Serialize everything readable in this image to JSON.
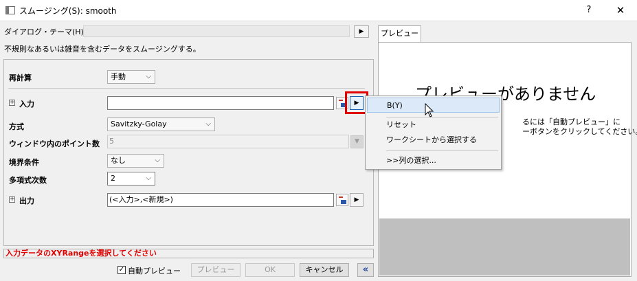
{
  "window": {
    "title": "スムージング(S): smooth",
    "help": "?",
    "close": "✕"
  },
  "theme": {
    "label": "ダイアログ・テーマ(H)",
    "arrow": "▶"
  },
  "description": "不規則なあるいは雑音を含むデータをスムージングする。",
  "form": {
    "recalc": {
      "label": "再計算",
      "value": "手動"
    },
    "input": {
      "label": "入力",
      "value": "",
      "expander": "⊞",
      "arrow": "▶"
    },
    "method": {
      "label": "方式",
      "value": "Savitzky-Golay"
    },
    "window_points": {
      "label": "ウィンドウ内のポイント数",
      "value": "5"
    },
    "boundary": {
      "label": "境界条件",
      "value": "なし"
    },
    "poly_order": {
      "label": "多項式次数",
      "value": "2"
    },
    "output": {
      "label": "出力",
      "value": "(<入力>,<新規>)",
      "expander": "⊞",
      "arrow": "▶"
    }
  },
  "status_message": "入力データのXYRangeを選択してください",
  "footer": {
    "auto_preview_label": "自動プレビュー",
    "auto_preview_checked": "✓",
    "preview_button": "プレビュー",
    "ok_button": "OK",
    "cancel_button": "キャンセル",
    "collapse_button": "«"
  },
  "preview": {
    "tab_label": "プレビュー",
    "title": "プレビューがありません",
    "message_line1": "るには「自動プレビュー」に",
    "message_line2": "ーボタンをクリックしてください。"
  },
  "context_menu": {
    "items": [
      "B(Y)",
      "リセット",
      "ワークシートから選択する",
      ">>列の選択..."
    ]
  },
  "icons": {
    "chevron": "⌵"
  }
}
